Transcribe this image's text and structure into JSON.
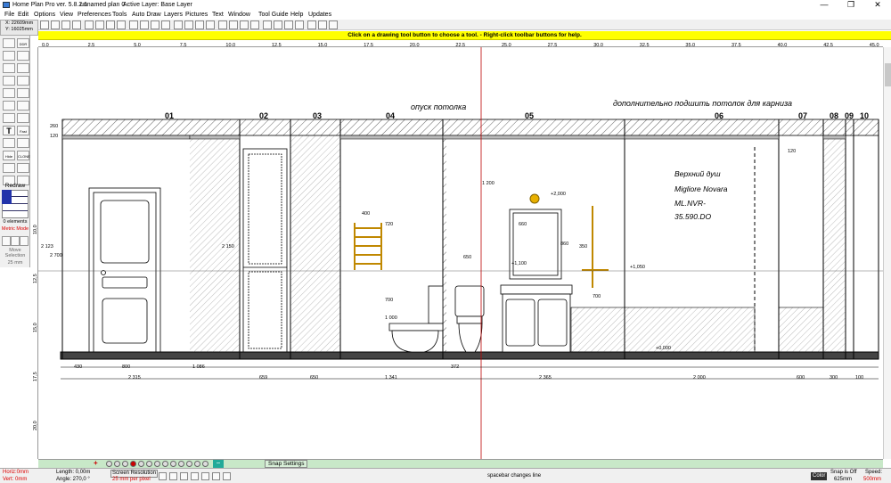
{
  "titlebar": {
    "app_title": "Home Plan Pro ver. 5.8.2.1",
    "plan_name": "unnamed plan 0",
    "active_layer": "Active Layer: Base Layer",
    "minimize": "—",
    "maximize": "❐",
    "close": "✕"
  },
  "menu": [
    "File",
    "Edit",
    "Options",
    "View",
    "Preferences",
    "Tools",
    "Auto Draw",
    "Layers",
    "Pictures",
    "Text",
    "Window",
    "Tool Guide",
    "Help",
    "Updates"
  ],
  "coords": {
    "x": "X: 22609mm",
    "y": "Y: 16025mm"
  },
  "hint": "Click on a drawing tool button to choose a tool. - Right-click toolbar buttons for help.",
  "ruler_top": [
    "0,0",
    "2,5",
    "5,0",
    "7,5",
    "10,0",
    "12,5",
    "15,0",
    "17,5",
    "20,0",
    "22,5",
    "25,0",
    "27,5",
    "30,0",
    "32,5",
    "35,0",
    "37,5",
    "40,0",
    "42,5",
    "45,0"
  ],
  "ruler_left": [
    "10,0",
    "12,5",
    "15,0",
    "17,5",
    "20,0"
  ],
  "leftpanel": {
    "redraw": "Redraw",
    "elements": "0 elements",
    "metric": "Metric Mode",
    "move_selection": "Move Selection",
    "move_step": "25 mm",
    "btn_ddr": "DDR",
    "btn_fast": "Fast",
    "btn_hide": "Hide",
    "btn_clone": "CLONE"
  },
  "drawing": {
    "zone_numbers": [
      "01",
      "02",
      "03",
      "04",
      "05",
      "06",
      "07",
      "08",
      "09",
      "10"
    ],
    "note_ceiling": "опуск потолка",
    "note_cornice": "дополнительно подшить потолок для карниза",
    "shower_note": [
      "Верхний душ",
      "Migliore Novara",
      "ML.NVR-",
      "35.590.DO"
    ],
    "height_dims": [
      "120",
      "260",
      "2 123",
      "2 700",
      "2 150",
      "700",
      "720",
      "1 000",
      "860",
      "120"
    ],
    "inner_dims": [
      "400",
      "1 200",
      "660",
      "350",
      "650",
      "700",
      "+2,000",
      "+1,100",
      "+1,050",
      "+0,000"
    ],
    "bottom_dims_row1": [
      "430",
      "800",
      "1 086",
      "372"
    ],
    "bottom_dims_row2": [
      "2 315",
      "659",
      "650",
      "1 341",
      "2 365",
      "2 000",
      "600",
      "300",
      "100"
    ]
  },
  "snap_settings": "Snap Settings",
  "status": {
    "horiz": "Horiz:0mm",
    "vert": "Vert: 0mm",
    "length": "Length: 0,00m",
    "angle": "Angle: 270,0 °",
    "screen_res": "Screen Resolution",
    "res_value": "25 mm per pixel",
    "message": "spacebar changes line",
    "color": "Color",
    "snap": "Snap is Off",
    "snap_value": "625mm",
    "speed": "Speed:",
    "speed_value": "500mm"
  },
  "colors": {
    "hint_bg": "#ffff00",
    "red_text": "#dd0000",
    "hscroll_bg": "#c8e8c8"
  }
}
